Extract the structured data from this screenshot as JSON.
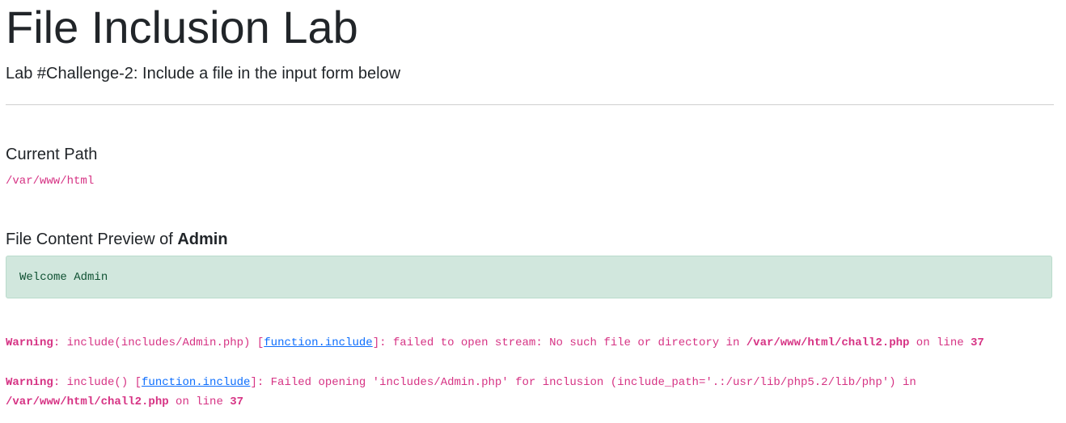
{
  "header": {
    "title": "File Inclusion Lab",
    "subtitle": "Lab #Challenge-2: Include a file in the input form below"
  },
  "current_path": {
    "heading": "Current Path",
    "value": "/var/www/html"
  },
  "preview": {
    "heading_prefix": "File Content Preview of ",
    "file_name": "Admin",
    "content": "Welcome Admin"
  },
  "warnings": [
    {
      "label": "Warning",
      "before_link": ": include(includes/Admin.php) [",
      "link_text": "function.include",
      "after_link": "]: failed to open stream: No such file or directory in ",
      "file": "/var/www/html/chall2.php",
      "line_text": " on line ",
      "line_number": "37"
    },
    {
      "label": "Warning",
      "before_link": ": include() [",
      "link_text": "function.include",
      "after_link": "]: Failed opening 'includes/Admin.php' for inclusion (include_path='.:/usr/lib/php5.2/lib/php') in ",
      "file": "/var/www/html/chall2.php",
      "line_text": " on line ",
      "line_number": "37"
    }
  ],
  "colors": {
    "code_text": "#d63384",
    "link": "#0d6efd",
    "success_background": "#d1e7dd",
    "success_text": "#0f5132"
  }
}
